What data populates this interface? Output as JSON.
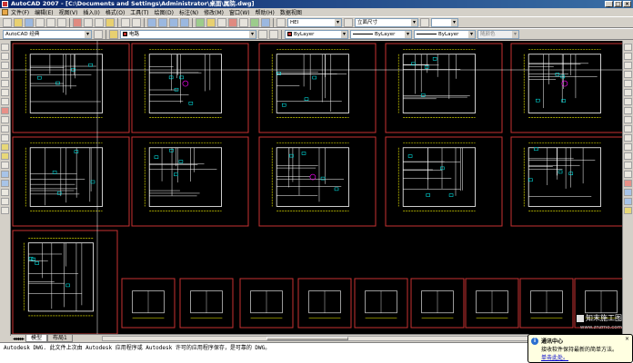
{
  "window": {
    "title": "AutoCAD 2007 - [C:\\Documents and Settings\\Administrator\\桌面\\属院.dwg]",
    "min": "_",
    "max": "□",
    "close": "×"
  },
  "menu": [
    "文件(F)",
    "编辑(E)",
    "视图(V)",
    "插入(I)",
    "格式(O)",
    "工具(T)",
    "绘图(D)",
    "标注(N)",
    "修改(M)",
    "窗口(W)",
    "帮助(H)",
    "数据视图"
  ],
  "toolbar": {
    "workspace": "AutoCAD 经典",
    "layer": "电路",
    "color": "ByLayer",
    "linetype": "ByLayer",
    "lineweight": "ByLayer",
    "plotstyle": "随颜色",
    "textstyle": "HEI",
    "dimstyle": "立面尺寸"
  },
  "tabs": {
    "nav": "◂◂◂▸▸▸",
    "items": [
      "模型",
      "布局1"
    ],
    "active": 0
  },
  "command": {
    "line1": "Autodesk DWG. 此文件上次由 Autodesk 应用程序或 Autodesk 许可的应用程序保存，是可靠的 DWG。",
    "line2": ""
  },
  "bubble": {
    "title": "通讯中心",
    "body": "接收软件保持最新的简单方法。",
    "link": "单击此处。",
    "close": "×",
    "icon": "i"
  },
  "watermark": {
    "text": "知末施工图",
    "url": "www.znzmo.com"
  },
  "colors": {
    "canvas": "#000000",
    "frame": "#c83232",
    "plan_lines": "#ffffff",
    "dims": "#ffff00",
    "accent_magenta": "#ff00ff",
    "accent_cyan": "#00ffff"
  }
}
